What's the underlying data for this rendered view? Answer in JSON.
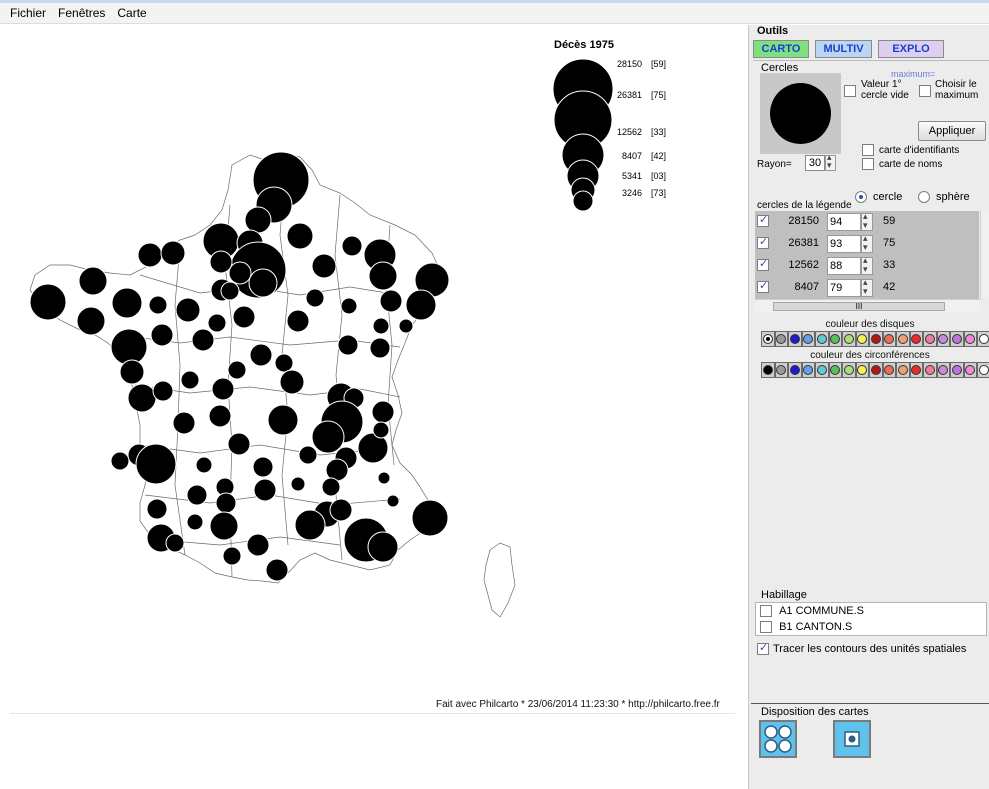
{
  "menu": [
    "Fichier",
    "Fenêtres",
    "Carte"
  ],
  "map": {
    "legend_title": "Décès 1975",
    "legend_entries": [
      {
        "value": "28150",
        "id": "[59]"
      },
      {
        "value": "26381",
        "id": "[75]"
      },
      {
        "value": "12562",
        "id": "[33]"
      },
      {
        "value": "8407",
        "id": "[42]"
      },
      {
        "value": "5341",
        "id": "[03]"
      },
      {
        "value": "3246",
        "id": "[73]"
      }
    ],
    "footer": "Fait avec Philcarto * 23/06/2014 11:23:30 * http://philcarto.free.fr",
    "disc_color": "#000000",
    "outline_color": "#ffffff",
    "border_color": "#6a6a6a"
  },
  "panel": {
    "title": "Outils",
    "tabs": [
      {
        "label": "CARTO",
        "color": "#7fe07f"
      },
      {
        "label": "MULTIV",
        "color": "#b9d6f2"
      },
      {
        "label": "EXPLO",
        "color": "#dccff0"
      }
    ],
    "cercles": {
      "label": "Cercles",
      "maximum_hint": "maximum=",
      "valeur_label": "Valeur 1°\ncercle vide",
      "choisir_label": "Choisir le\nmaximum",
      "apply_label": "Appliquer",
      "carte_ident_label": "carte d'identifiants",
      "carte_noms_label": "carte de noms",
      "rayon_label": "Rayon=",
      "rayon_value": "30"
    },
    "legend_circles": {
      "label": "cercles de la légende",
      "option_cercle": "cercle",
      "option_sphere": "sphère",
      "rows": [
        {
          "value": "28150",
          "size": "94",
          "id": "59"
        },
        {
          "value": "26381",
          "size": "93",
          "id": "75"
        },
        {
          "value": "12562",
          "size": "88",
          "id": "33"
        },
        {
          "value": "8407",
          "size": "79",
          "id": "42"
        }
      ],
      "scroll_label": "III"
    },
    "colors": {
      "disques_label": "couleur des disques",
      "circonferences_label": "couleur des circonférences",
      "palette": [
        "#000000",
        "#9a9a9a",
        "#1b1bd0",
        "#66a0e8",
        "#63c8d8",
        "#58c058",
        "#a6e07a",
        "#f2f25a",
        "#b01818",
        "#f06a5a",
        "#f0a070",
        "#e82a2a",
        "#f07aa0",
        "#c98ad8",
        "#c070e0",
        "#f08ad8",
        "#ffffff"
      ]
    },
    "habillage": {
      "label": "Habillage",
      "items": [
        "A1  COMMUNE.S",
        "B1  CANTON.S"
      ],
      "contours_label": "Tracer les contours des unités spatiales"
    },
    "disposition": {
      "label": "Disposition des cartes"
    }
  }
}
